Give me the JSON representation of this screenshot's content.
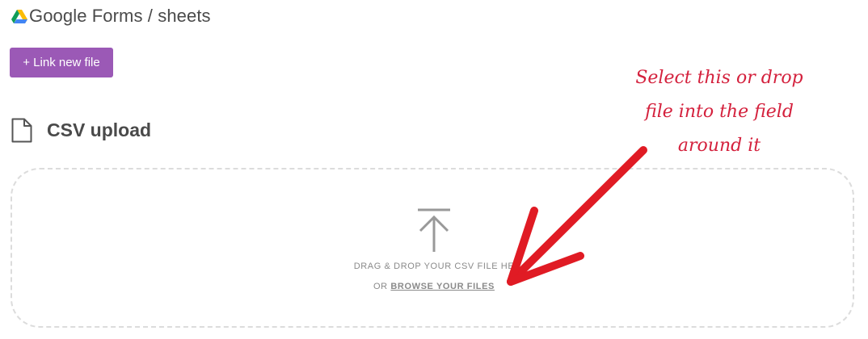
{
  "header": {
    "title": "Google Forms / sheets",
    "icon": "google-drive-icon"
  },
  "actions": {
    "link_new_file_label": "+ Link new file"
  },
  "csv_upload": {
    "title": "CSV upload",
    "icon": "file-icon",
    "dropzone": {
      "line1": "DRAG & DROP YOUR CSV FILE HE",
      "or_text": "OR",
      "browse_label": "BROWSE YOUR FILES",
      "icon": "upload-arrow-icon"
    }
  },
  "annotation": {
    "lines": [
      "Select this or drop",
      "file into the field",
      "around it"
    ],
    "color": "#d4213d"
  },
  "colors": {
    "accent": "#9b59b6",
    "text": "#4a4a4a",
    "muted": "#8a8a8a",
    "dropzone_border": "#dcdcdc"
  }
}
